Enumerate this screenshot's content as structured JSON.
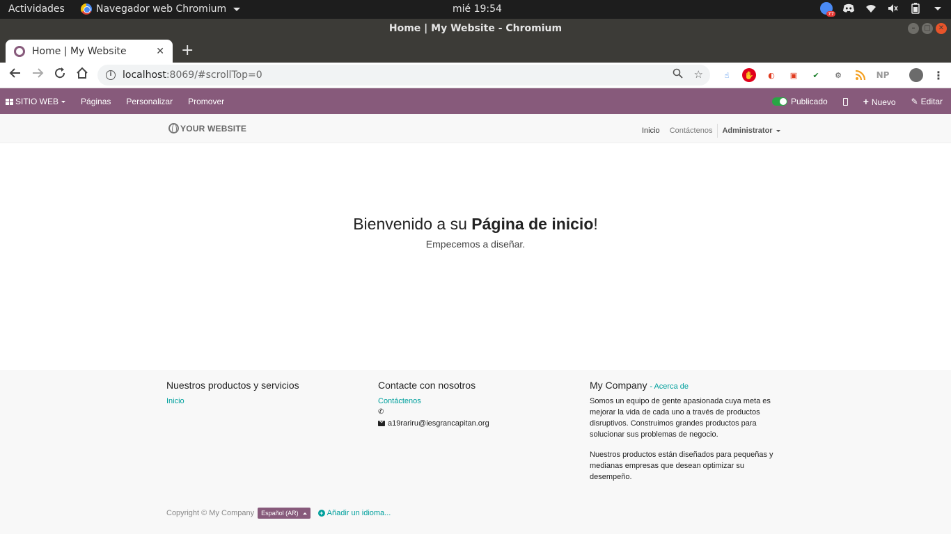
{
  "gnome": {
    "activities": "Actividades",
    "app_name": "Navegador web Chromium",
    "clock": "mié 19:54",
    "tray_badge": "77"
  },
  "window": {
    "title": "Home | My Website - Chromium"
  },
  "browser": {
    "tab_title": "Home | My Website",
    "new_tab": "+",
    "url_host": "localhost",
    "url_rest": ":8069/#scrollTop=0",
    "ext_np": "NP"
  },
  "odoo_bar": {
    "apps_label": "SITIO WEB",
    "menu": [
      "Páginas",
      "Personalizar",
      "Promover"
    ],
    "published_label": "Publicado",
    "new_label": "Nuevo",
    "edit_label": "Editar",
    "published": true
  },
  "site_header": {
    "logo_text": "YOUR WEBSITE",
    "nav": [
      "Inicio",
      "Contáctenos"
    ],
    "user": "Administrator"
  },
  "hero": {
    "title_pre": "Bienvenido a su ",
    "title_bold": "Página de inicio",
    "title_post": "!",
    "subtitle": "Empecemos a diseñar."
  },
  "footer": {
    "col1": {
      "title": "Nuestros productos y servicios",
      "links": [
        "Inicio"
      ]
    },
    "col2": {
      "title": "Contacte con nosotros",
      "link": "Contáctenos",
      "email": "a19rariru@iesgrancapitan.org"
    },
    "col3": {
      "title": "My Company",
      "title_link": "- Acerca de",
      "para1": "Somos un equipo de gente apasionada cuya meta es mejorar la vida de cada uno a través de productos disruptivos. Construimos grandes productos para solucionar sus problemas de negocio.",
      "para2": "Nuestros productos están diseñados para pequeñas y medianas empresas que desean optimizar su desempeño."
    },
    "copyright": "Copyright © My Company",
    "language": "Español (AR)",
    "add_language": "Añadir un idioma..."
  },
  "colors": {
    "odoo_purple": "#875a7b",
    "odoo_teal": "#00a09d",
    "toggle_green": "#28a745"
  }
}
